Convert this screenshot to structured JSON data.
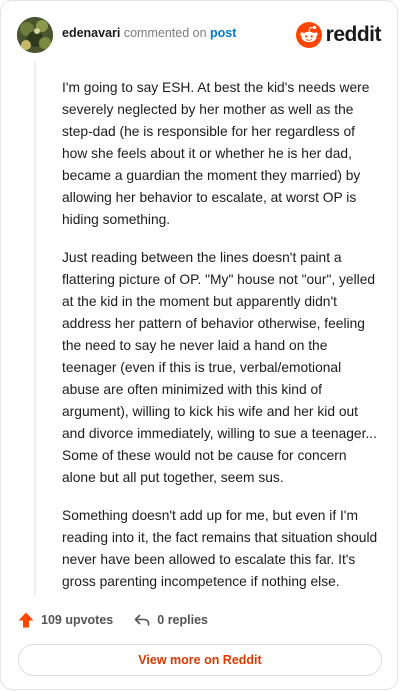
{
  "header": {
    "username": "edenavari",
    "action_text": "commented on",
    "post_link": "post",
    "brand_name": "reddit"
  },
  "comment": {
    "paragraphs": [
      "I'm going to say ESH. At best the kid's needs were severely neglected by her mother as well as the step-dad (he is responsible for her regardless of how she feels about it or whether he is her dad, became a guardian the moment they married) by allowing her behavior to escalate, at worst OP is hiding something.",
      "Just reading between the lines doesn't paint a flattering picture of OP. \"My\" house not \"our\", yelled at the kid in the moment but apparently didn't address her pattern of behavior otherwise, feeling the need to say he never laid a hand on the teenager (even if this is true, verbal/emotional abuse are often minimized with this kind of argument), willing to kick his wife and her kid out and divorce immediately, willing to sue a teenager... Some of these would not be cause for concern alone but all put together, seem sus.",
      "Something doesn't add up for me, but even if I'm reading into it, the fact remains that situation should never have been allowed to escalate this far. It's gross parenting incompetence if nothing else."
    ]
  },
  "actions": {
    "upvotes_label": "109 upvotes",
    "replies_label": "0 replies"
  },
  "footer": {
    "view_more_label": "View more on Reddit"
  },
  "colors": {
    "brand_orange": "#ff4500",
    "link_blue": "#0079d3",
    "view_more_text": "#d93a00"
  },
  "icons": {
    "upvote": "upvote-arrow-icon",
    "reply": "reply-arrow-icon",
    "brand": "reddit-snoo-icon"
  }
}
